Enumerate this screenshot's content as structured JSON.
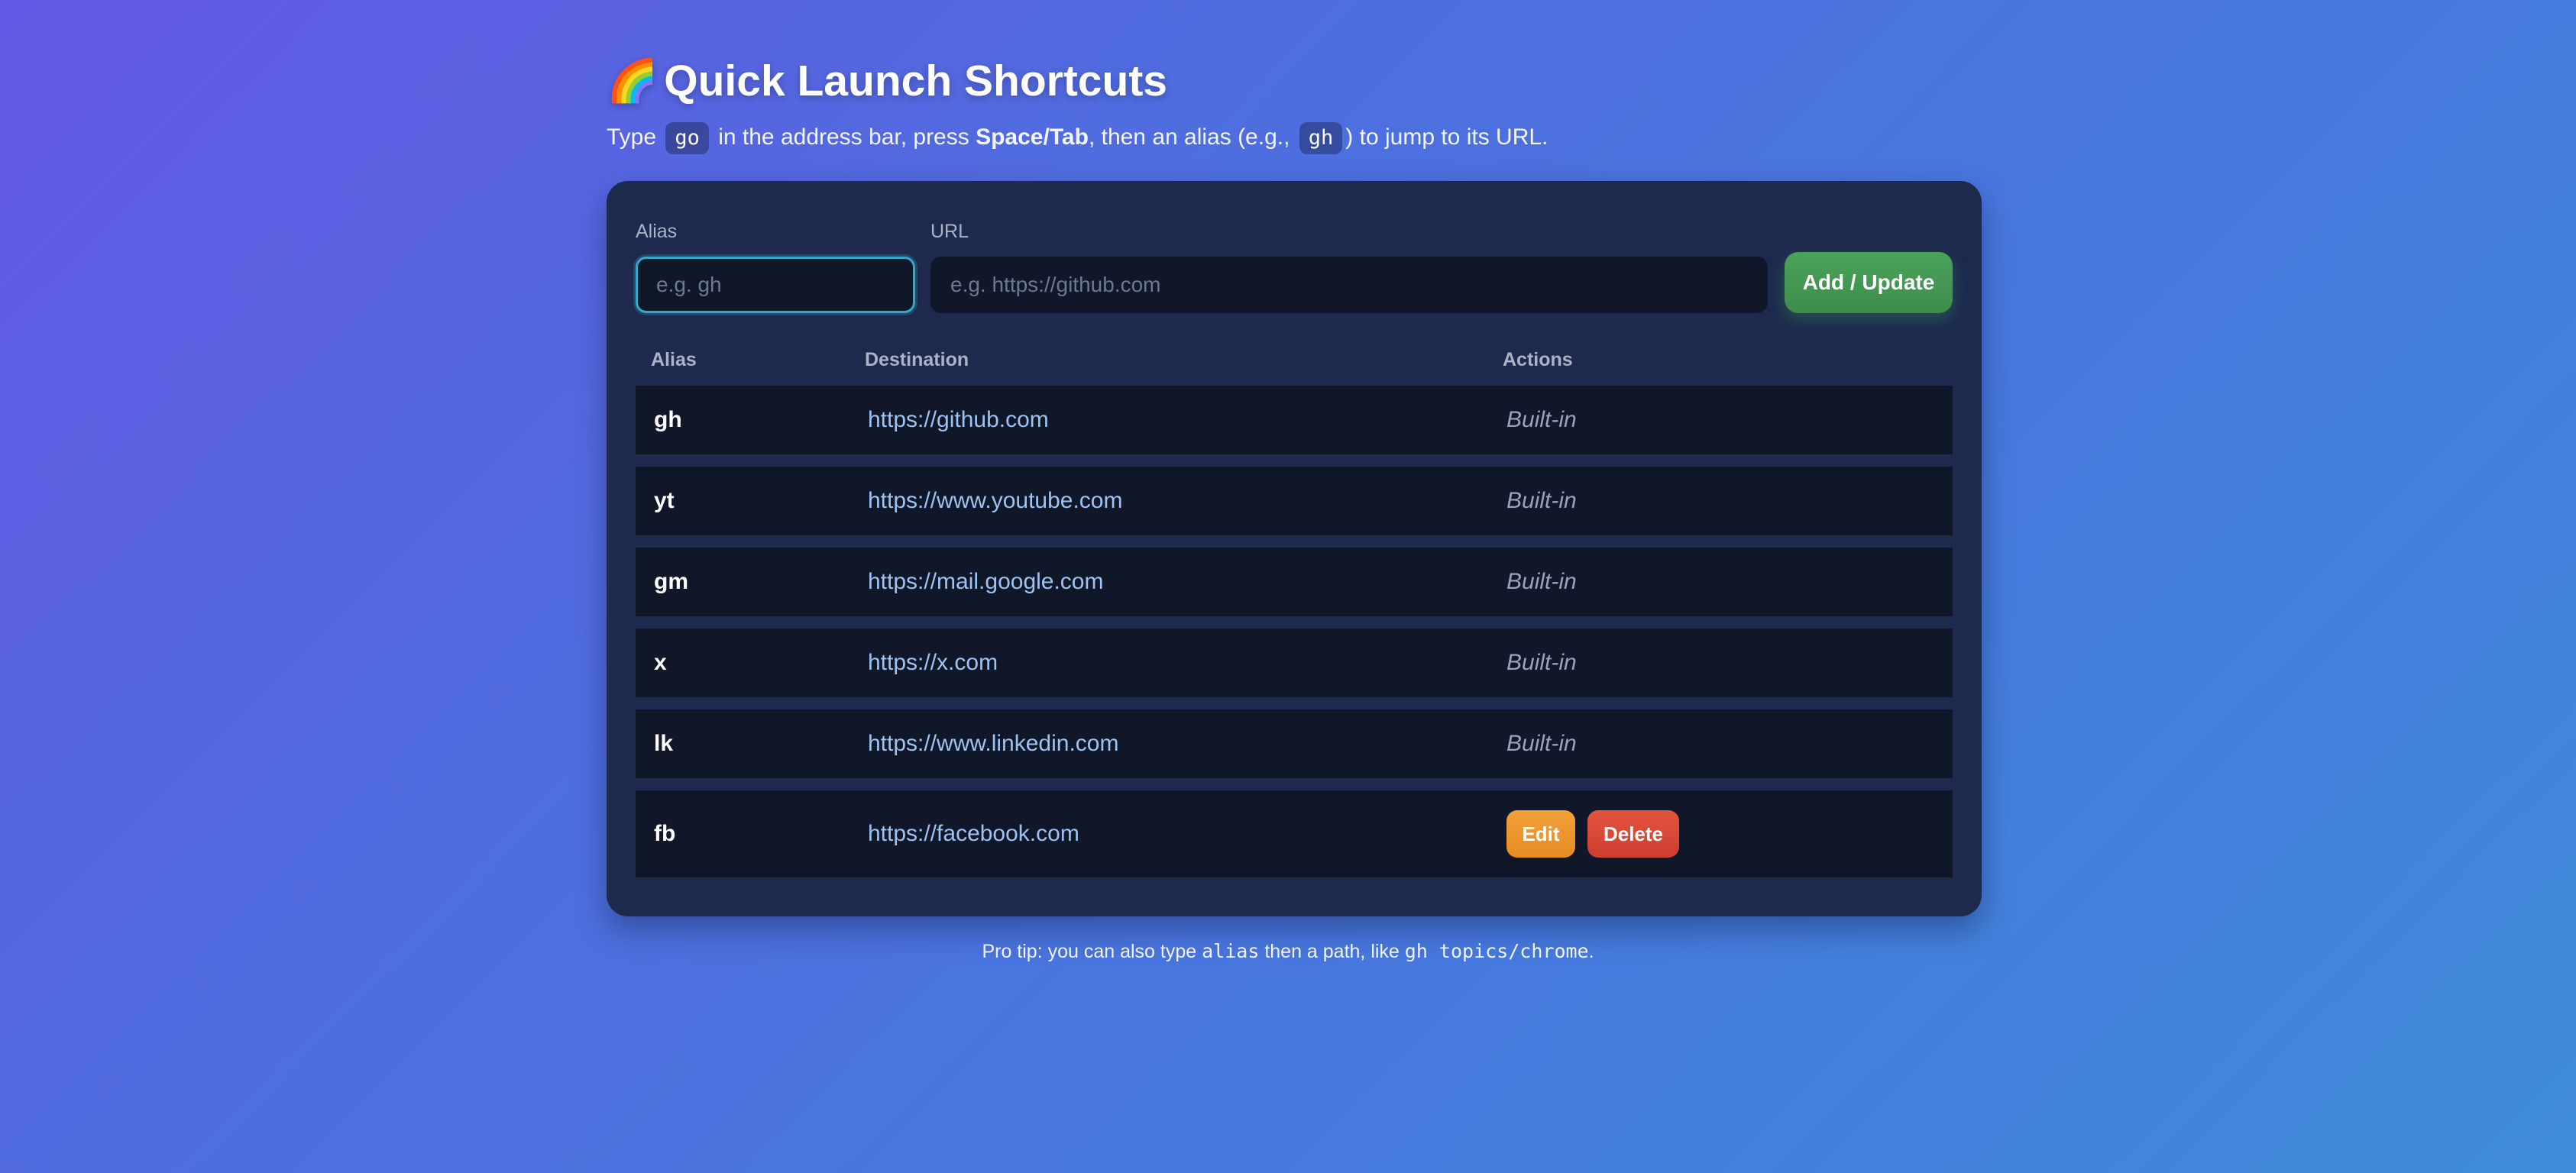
{
  "header": {
    "emoji": "🌈",
    "title": "Quick Launch Shortcuts",
    "subtitle": {
      "part1": "Type ",
      "keyword": "go",
      "part2": " in the address bar, press ",
      "keys": "Space/Tab",
      "part3": ", then an alias (e.g., ",
      "example_alias": "gh",
      "part4": ") to jump to its URL."
    }
  },
  "form": {
    "alias_label": "Alias",
    "alias_placeholder": "e.g. gh",
    "url_label": "URL",
    "url_placeholder": "e.g. https://github.com",
    "submit_label": "Add / Update"
  },
  "table": {
    "headers": [
      "Alias",
      "Destination",
      "Actions"
    ],
    "rows": [
      {
        "alias": "gh",
        "url": "https://github.com",
        "action": "Built-in"
      },
      {
        "alias": "yt",
        "url": "https://www.youtube.com",
        "action": "Built-in"
      },
      {
        "alias": "gm",
        "url": "https://mail.google.com",
        "action": "Built-in"
      },
      {
        "alias": "x",
        "url": "https://x.com",
        "action": "Built-in"
      },
      {
        "alias": "lk",
        "url": "https://www.linkedin.com",
        "action": "Built-in"
      },
      {
        "alias": "fb",
        "url": "https://facebook.com",
        "edit_label": "Edit",
        "delete_label": "Delete"
      }
    ]
  },
  "footer": {
    "tip_part1": "Pro tip: you can also type ",
    "tip_code1": "alias",
    "tip_part2": " then a path, like ",
    "tip_code2": "gh topics/chrome",
    "tip_part3": "."
  },
  "colors": {
    "accent_green": "#4aa35a",
    "edit_orange": "#f3a13a",
    "delete_red": "#e4553f",
    "link_blue": "#9ec3f3",
    "card_bg": "#1d2a4e",
    "row_bg": "#101729"
  }
}
